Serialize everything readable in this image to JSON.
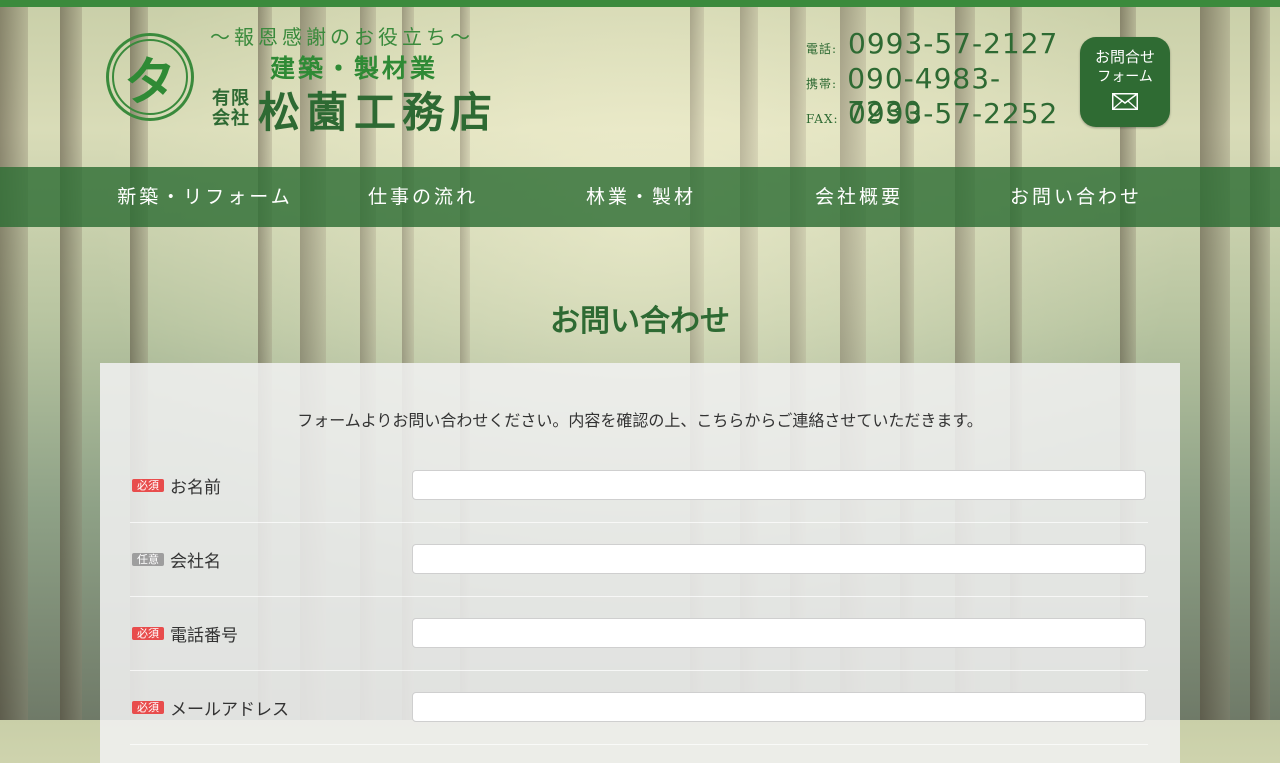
{
  "colors": {
    "brand_green": "#2e6a33",
    "accent_green": "#3b8a3c",
    "required": "#e84c4c",
    "optional": "#9e9e9e"
  },
  "header": {
    "logo_char": "タ",
    "slogan": "～報恩感謝のお役立ち～",
    "industry": "建築・製材業",
    "company_type": "有限会社",
    "company_name": "松薗工務店",
    "contacts": [
      {
        "label": "電話:",
        "number": "0993-57-2127"
      },
      {
        "label": "携帯:",
        "number": "090-4983-7230"
      },
      {
        "label": "FAX:",
        "number": "0993-57-2252"
      }
    ],
    "form_button": {
      "line1": "お問合せ",
      "line2": "フォーム",
      "icon": "mail-icon"
    }
  },
  "nav": {
    "items": [
      {
        "label": "新築・リフォーム"
      },
      {
        "label": "仕事の流れ"
      },
      {
        "label": "林業・製材"
      },
      {
        "label": "会社概要"
      },
      {
        "label": "お問い合わせ"
      }
    ]
  },
  "main": {
    "title": "お問い合わせ",
    "intro": "フォームよりお問い合わせください。内容を確認の上、こちらからご連絡させていただきます。",
    "fields": [
      {
        "badge": "必須",
        "label": "お名前",
        "value": "",
        "placeholder": ""
      },
      {
        "badge": "任意",
        "label": "会社名",
        "value": "",
        "placeholder": ""
      },
      {
        "badge": "必須",
        "label": "電話番号",
        "value": "",
        "placeholder": ""
      },
      {
        "badge": "必須",
        "label": "メールアドレス",
        "value": "",
        "placeholder": ""
      }
    ]
  }
}
